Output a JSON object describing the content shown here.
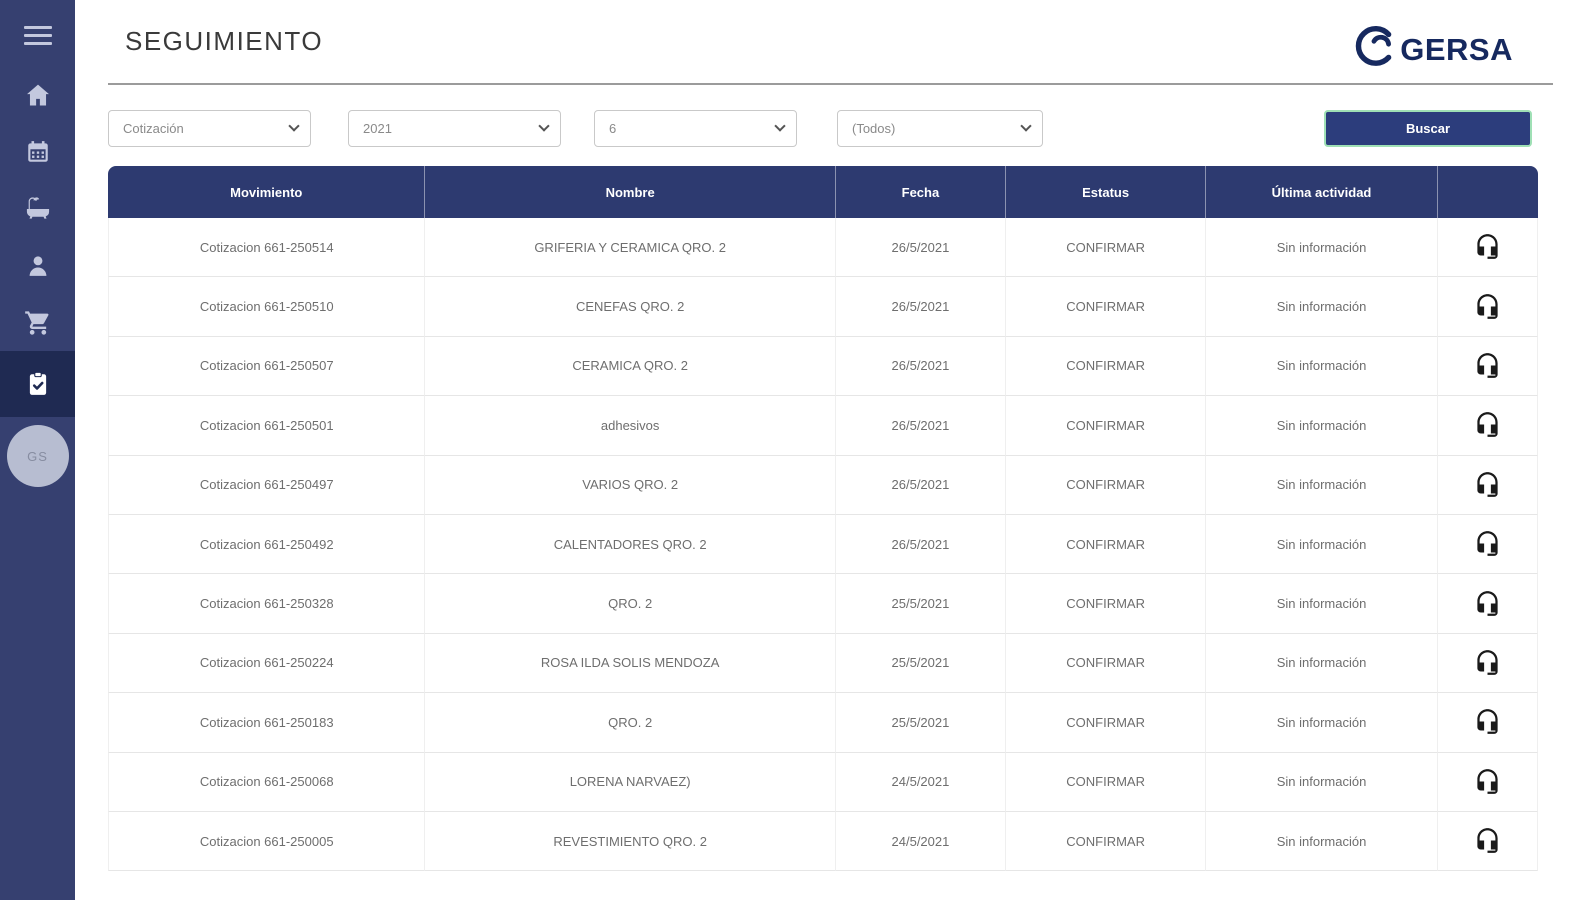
{
  "colors": {
    "sidebar": "#364070",
    "sidebar_active": "#1f2a52",
    "table_header": "#2d3a70",
    "button": "#2c3d7c",
    "button_focus_ring": "#9fe0b5",
    "logo_navy": "#16295f"
  },
  "sidebar": {
    "avatar_initials": "GS",
    "items": [
      {
        "id": "menu",
        "icon": "hamburger-icon"
      },
      {
        "id": "home",
        "icon": "home-icon"
      },
      {
        "id": "calendar",
        "icon": "calendar-icon"
      },
      {
        "id": "bath",
        "icon": "bath-icon"
      },
      {
        "id": "clients",
        "icon": "user-icon"
      },
      {
        "id": "cart",
        "icon": "cart-icon"
      },
      {
        "id": "tracking",
        "icon": "clipboard-check-icon",
        "active": true
      }
    ]
  },
  "header": {
    "title": "SEGUIMIENTO",
    "logo_text": "GERSA"
  },
  "filters": {
    "movement_type": "Cotización",
    "year": "2021",
    "month": "6",
    "status": "(Todos)",
    "search_label": "Buscar"
  },
  "table": {
    "columns": [
      "Movimiento",
      "Nombre",
      "Fecha",
      "Estatus",
      "Última actividad",
      ""
    ],
    "row_action_icon": "headset-icon",
    "rows": [
      {
        "movimiento": "Cotizacion 661-250514",
        "nombre": "GRIFERIA Y CERAMICA QRO. 2",
        "fecha": "26/5/2021",
        "estatus": "CONFIRMAR",
        "actividad": "Sin información"
      },
      {
        "movimiento": "Cotizacion 661-250510",
        "nombre": "CENEFAS QRO. 2",
        "fecha": "26/5/2021",
        "estatus": "CONFIRMAR",
        "actividad": "Sin información"
      },
      {
        "movimiento": "Cotizacion 661-250507",
        "nombre": "CERAMICA QRO. 2",
        "fecha": "26/5/2021",
        "estatus": "CONFIRMAR",
        "actividad": "Sin información"
      },
      {
        "movimiento": "Cotizacion 661-250501",
        "nombre": "adhesivos",
        "fecha": "26/5/2021",
        "estatus": "CONFIRMAR",
        "actividad": "Sin información"
      },
      {
        "movimiento": "Cotizacion 661-250497",
        "nombre": "VARIOS QRO. 2",
        "fecha": "26/5/2021",
        "estatus": "CONFIRMAR",
        "actividad": "Sin información"
      },
      {
        "movimiento": "Cotizacion 661-250492",
        "nombre": "CALENTADORES QRO. 2",
        "fecha": "26/5/2021",
        "estatus": "CONFIRMAR",
        "actividad": "Sin información"
      },
      {
        "movimiento": "Cotizacion 661-250328",
        "nombre": "QRO. 2",
        "fecha": "25/5/2021",
        "estatus": "CONFIRMAR",
        "actividad": "Sin información"
      },
      {
        "movimiento": "Cotizacion 661-250224",
        "nombre": "ROSA ILDA SOLIS MENDOZA",
        "fecha": "25/5/2021",
        "estatus": "CONFIRMAR",
        "actividad": "Sin información"
      },
      {
        "movimiento": "Cotizacion 661-250183",
        "nombre": "QRO. 2",
        "fecha": "25/5/2021",
        "estatus": "CONFIRMAR",
        "actividad": "Sin información"
      },
      {
        "movimiento": "Cotizacion 661-250068",
        "nombre": "LORENA NARVAEZ)",
        "fecha": "24/5/2021",
        "estatus": "CONFIRMAR",
        "actividad": "Sin información"
      },
      {
        "movimiento": "Cotizacion 661-250005",
        "nombre": "REVESTIMIENTO QRO. 2",
        "fecha": "24/5/2021",
        "estatus": "CONFIRMAR",
        "actividad": "Sin información"
      }
    ]
  }
}
